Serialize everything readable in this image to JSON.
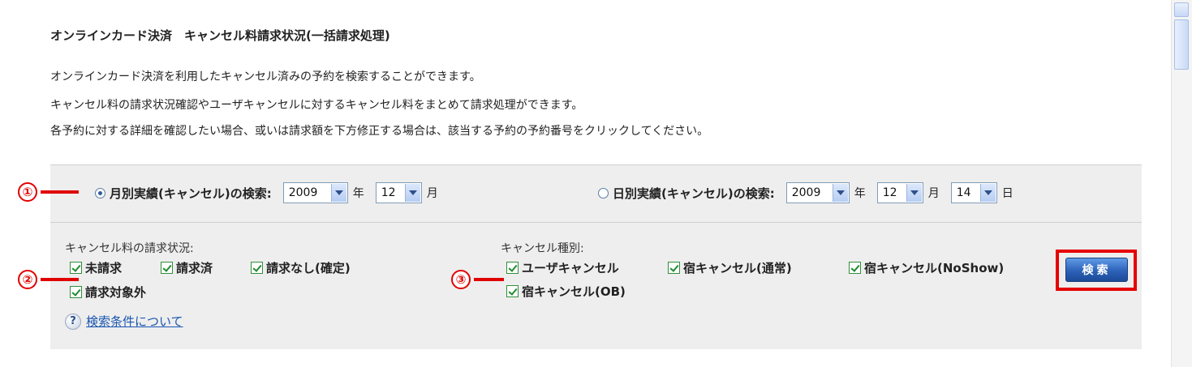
{
  "page_title": "オンラインカード決済　キャンセル料請求状況(一括請求処理)",
  "description": [
    "オンラインカード決済を利用したキャンセル済みの予約を検索することができます。",
    "キャンセル料の請求状況確認やユーザキャンセルに対するキャンセル料をまとめて請求処理ができます。",
    "各予約に対する詳細を確認したい場合、或いは請求額を下方修正する場合は、該当する予約の予約番号をクリックしてください。"
  ],
  "monthly": {
    "label": "月別実績(キャンセル)の検索:",
    "selected": true,
    "year": "2009",
    "year_unit": "年",
    "month": "12",
    "month_unit": "月"
  },
  "daily": {
    "label": "日別実績(キャンセル)の検索:",
    "selected": false,
    "year": "2009",
    "year_unit": "年",
    "month": "12",
    "month_unit": "月",
    "day": "14",
    "day_unit": "日"
  },
  "billing_status": {
    "label": "キャンセル料の請求状況:",
    "options": [
      "未請求",
      "請求済",
      "請求なし(確定)",
      "請求対象外"
    ]
  },
  "cancel_type": {
    "label": "キャンセル種別:",
    "options": [
      "ユーザキャンセル",
      "宿キャンセル(通常)",
      "宿キャンセル(NoShow)",
      "宿キャンセル(OB)"
    ]
  },
  "help_link": "検索条件について",
  "help_icon": "?",
  "search_button": "検索",
  "markers": [
    "①",
    "②",
    "③"
  ],
  "colors": {
    "marker": "#e00000",
    "panel": "#eeeeee",
    "button": "#2c62b8",
    "link": "#1a56b0"
  }
}
